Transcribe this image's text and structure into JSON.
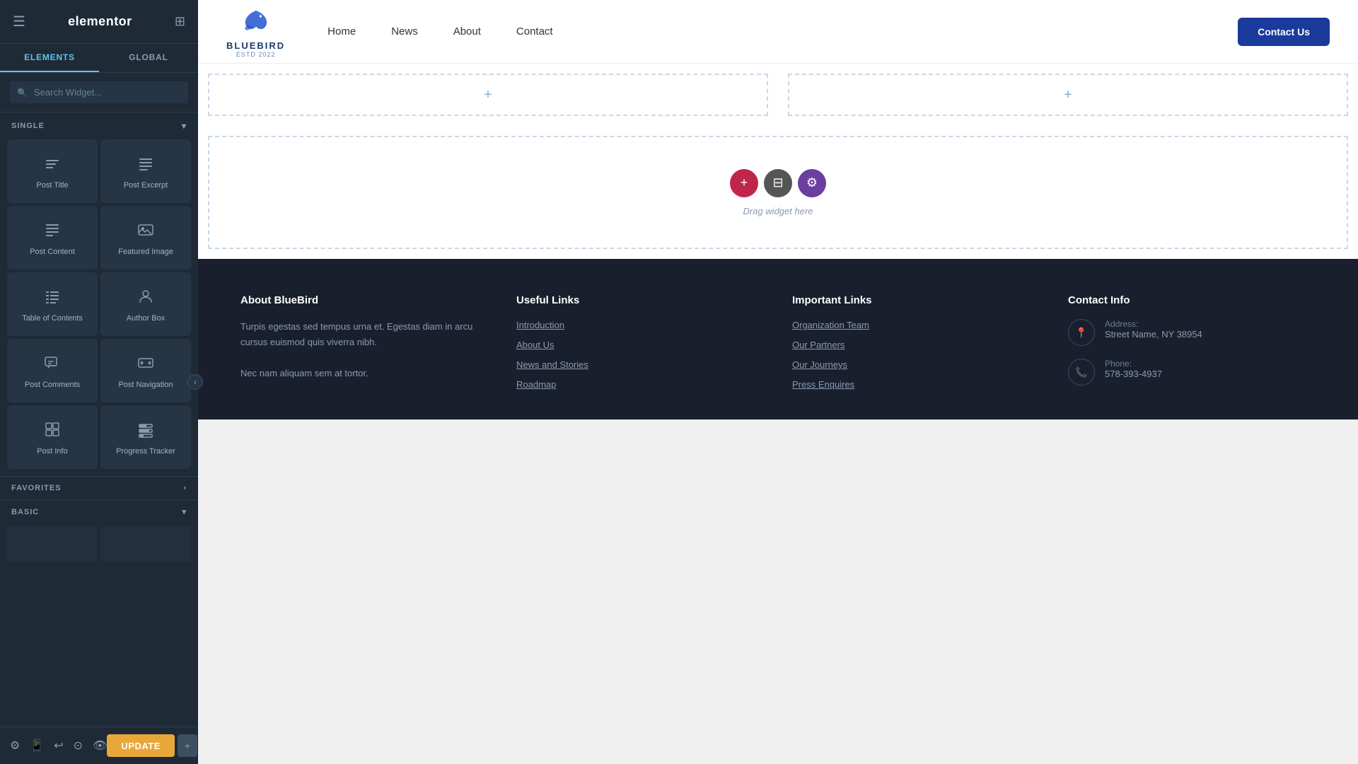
{
  "panel": {
    "logo": "elementor",
    "tabs": [
      {
        "label": "ELEMENTS",
        "active": true
      },
      {
        "label": "GLOBAL",
        "active": false
      }
    ],
    "search_placeholder": "Search Widget...",
    "single_section": "SINGLE",
    "favorites_section": "FAVORITES",
    "basic_section": "BASIC",
    "widgets": [
      {
        "id": "post-title",
        "label": "Post Title",
        "icon": "T"
      },
      {
        "id": "post-excerpt",
        "label": "Post Excerpt",
        "icon": "≡"
      },
      {
        "id": "post-content",
        "label": "Post Content",
        "icon": "☰"
      },
      {
        "id": "featured-image",
        "label": "Featured Image",
        "icon": "🖼"
      },
      {
        "id": "table-of-contents",
        "label": "Table of Contents",
        "icon": "≣"
      },
      {
        "id": "author-box",
        "label": "Author Box",
        "icon": "👤"
      },
      {
        "id": "post-comments",
        "label": "Post Comments",
        "icon": "💬"
      },
      {
        "id": "post-navigation",
        "label": "Post Navigation",
        "icon": "↔"
      },
      {
        "id": "post-info",
        "label": "Post Info",
        "icon": "🔲"
      },
      {
        "id": "progress-tracker",
        "label": "Progress Tracker",
        "icon": "📊"
      }
    ],
    "update_button": "UPDATE"
  },
  "navbar": {
    "logo_text": "BLUEBIRD",
    "logo_sub": "ESTD 2022",
    "links": [
      {
        "label": "Home"
      },
      {
        "label": "News"
      },
      {
        "label": "About"
      },
      {
        "label": "Contact"
      }
    ],
    "contact_btn": "Contact Us"
  },
  "canvas": {
    "drag_label": "Drag widget here",
    "plus_label": "+"
  },
  "footer": {
    "about_title": "About BlueBird",
    "about_text": "Turpis egestas sed tempus urna et. Egestas diam in arcu cursus euismod quis viverra nibh.",
    "about_text2": "Nec nam aliquam sem at tortor.",
    "useful_links_title": "Useful Links",
    "useful_links": [
      {
        "label": "Introduction"
      },
      {
        "label": "About Us"
      },
      {
        "label": "News and Stories"
      },
      {
        "label": "Roadmap"
      }
    ],
    "important_links_title": "Important Links",
    "important_links": [
      {
        "label": "Organization Team"
      },
      {
        "label": "Our Partners"
      },
      {
        "label": "Our Journeys"
      },
      {
        "label": "Press Enquires"
      }
    ],
    "contact_title": "Contact Info",
    "address_label": "Address:",
    "address_value": "Street Name, NY 38954",
    "phone_label": "Phone:",
    "phone_value": "578-393-4937"
  }
}
